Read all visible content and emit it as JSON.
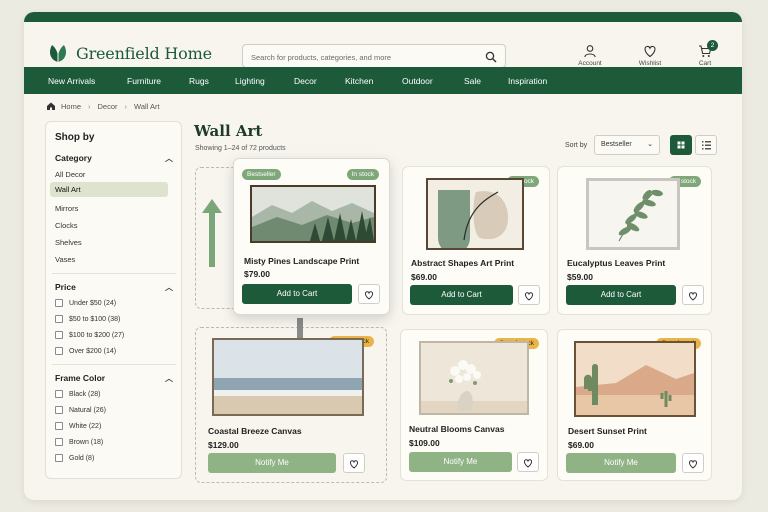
{
  "brand": {
    "name": "Greenfield Home",
    "accent": "#1d5a3a",
    "muted_button": "#8fb384"
  },
  "search": {
    "placeholder": "Search for products, categories, and more"
  },
  "header_actions": [
    {
      "label": "Account",
      "icon": "user-icon"
    },
    {
      "label": "Wishlist",
      "icon": "heart-icon"
    },
    {
      "label": "Cart",
      "icon": "cart-icon",
      "count": "2"
    }
  ],
  "nav": [
    "New Arrivals",
    "Furniture",
    "Rugs",
    "Lighting",
    "Decor",
    "Kitchen",
    "Outdoor",
    "Sale",
    "Inspiration"
  ],
  "breadcrumb": [
    "Home",
    "Decor",
    "Wall Art"
  ],
  "sidebar": {
    "title": "Shop by",
    "category": {
      "title": "Category",
      "items": [
        "All Decor",
        "Wall Art",
        "Mirrors",
        "Clocks",
        "Shelves",
        "Vases"
      ],
      "active": "Wall Art"
    },
    "price": {
      "title": "Price",
      "items": [
        "Under $50 (24)",
        "$50 to $100 (38)",
        "$100 to $200 (27)",
        "Over $200 (14)"
      ]
    },
    "frame_color": {
      "title": "Frame Color",
      "items": [
        "Black (28)",
        "Natural (26)",
        "White (22)",
        "Brown (18)",
        "Gold (8)"
      ]
    }
  },
  "main": {
    "title": "Wall Art",
    "showing": "Showing 1–24 of 72 products",
    "sort_label": "Sort by",
    "sort_value": "Bestseller"
  },
  "products": [
    {
      "name": "Misty Pines Landscape Print",
      "price": "$79.00",
      "badge": "In stock",
      "badge2": "Bestseller",
      "button": "Add to Cart"
    },
    {
      "name": "Abstract Shapes Art Print",
      "price": "$69.00",
      "badge": "In stock",
      "button": "Add to Cart"
    },
    {
      "name": "Eucalyptus Leaves Print",
      "price": "$59.00",
      "badge": "In stock",
      "button": "Add to Cart"
    },
    {
      "name": "Coastal Breeze Canvas",
      "price": "$129.00",
      "badge": "Out of stock",
      "button": "Notify Me"
    },
    {
      "name": "Neutral Blooms Canvas",
      "price": "$109.00",
      "badge": "Out of stock",
      "button": "Notify Me"
    },
    {
      "name": "Desert Sunset Print",
      "price": "$69.00",
      "badge": "Out of stock",
      "button": "Notify Me"
    }
  ]
}
